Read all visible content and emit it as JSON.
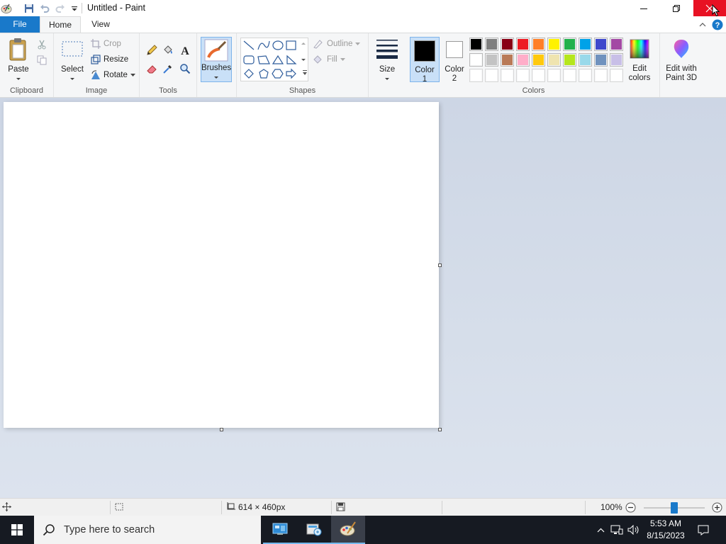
{
  "window": {
    "title": "Untitled - Paint"
  },
  "tabs": {
    "file": "File",
    "home": "Home",
    "view": "View"
  },
  "clipboard": {
    "paste": "Paste",
    "group": "Clipboard"
  },
  "image": {
    "select": "Select",
    "crop": "Crop",
    "resize": "Resize",
    "rotate": "Rotate",
    "group": "Image"
  },
  "tools": {
    "group": "Tools"
  },
  "brushes": {
    "label": "Brushes"
  },
  "shapes": {
    "outline": "Outline",
    "fill": "Fill",
    "group": "Shapes"
  },
  "size": {
    "label": "Size"
  },
  "colors": {
    "color1": "Color\n1",
    "color1_a": "Color",
    "color1_b": "1",
    "color2_a": "Color",
    "color2_b": "2",
    "edit_a": "Edit",
    "edit_b": "colors",
    "paint3d_a": "Edit with",
    "paint3d_b": "Paint 3D",
    "group": "Colors",
    "palette_row1": [
      "#000000",
      "#7f7f7f",
      "#880015",
      "#ed1c24",
      "#ff7f27",
      "#fff200",
      "#22b14c",
      "#00a2e8",
      "#3f48cc",
      "#a349a4"
    ],
    "palette_row2": [
      "#ffffff",
      "#c3c3c3",
      "#b97a57",
      "#ffaec9",
      "#ffc90e",
      "#efe4b0",
      "#b5e61d",
      "#99d9ea",
      "#7092be",
      "#c8bfe7"
    ],
    "primary": "#000000",
    "secondary": "#ffffff"
  },
  "status": {
    "dimensions": "614 × 460px",
    "zoom": "100%",
    "zoom_fraction": 0.5
  },
  "taskbar": {
    "search_placeholder": "Type here to search",
    "time": "5:53 AM",
    "date": "8/15/2023"
  }
}
